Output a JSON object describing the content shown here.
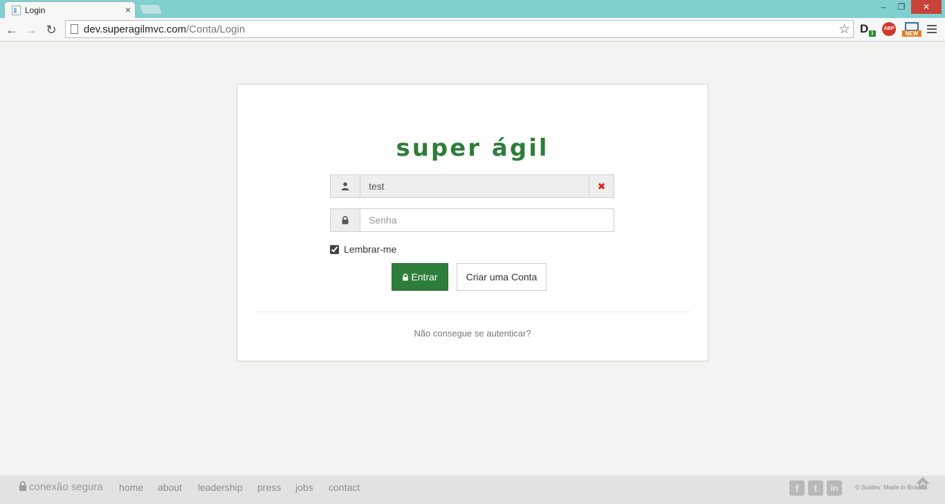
{
  "browser": {
    "tab_title": "Login",
    "tab_close": "×",
    "url_domain": "dev.superagilmvc.com",
    "url_path": "/Conta/Login",
    "ext_d_label": "D",
    "ext_d_badge": "1",
    "ext_abp_label": "ABP",
    "ext_new_label": "NEW",
    "window_min": "–",
    "window_max": "❐",
    "window_close": "✕"
  },
  "login": {
    "logo": "super ágil",
    "username_value": "test",
    "clear_symbol": "✖",
    "password_placeholder": "Senha",
    "remember_label": "Lembrar-me",
    "remember_checked": true,
    "login_button": "Entrar",
    "register_button": "Criar uma Conta",
    "forgot_link": "Não consegue se autenticar?"
  },
  "footer": {
    "secure_label": "conexão segura",
    "links": [
      "home",
      "about",
      "leadership",
      "press",
      "jobs",
      "contact"
    ],
    "social": [
      "f",
      "t",
      "in"
    ],
    "copyright": "© Suldev. Made in Brasil."
  },
  "colors": {
    "brand_green": "#2e7d3a",
    "tabbar": "#7fd1d0",
    "clear_red": "#d9241b"
  },
  "icons": {
    "username": "user-icon",
    "password": "lock-icon",
    "clear": "close-icon",
    "bookmark": "star-icon",
    "menu": "hamburger-icon"
  }
}
